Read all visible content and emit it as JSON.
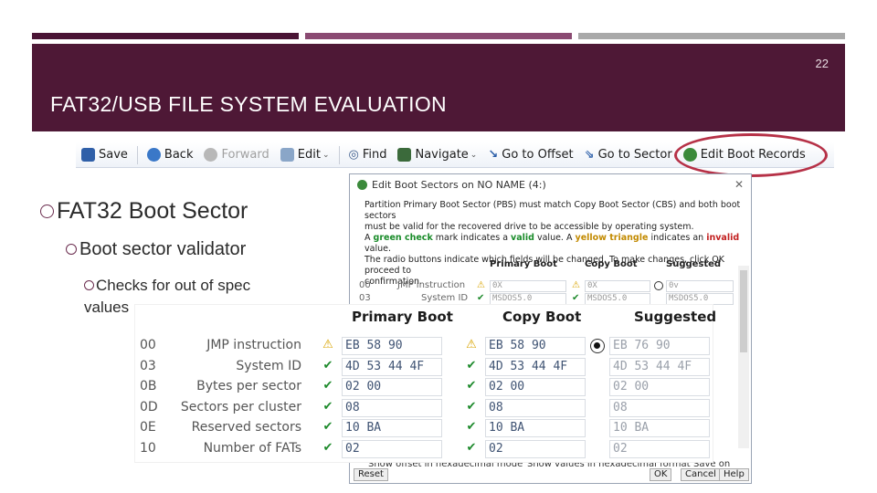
{
  "slide": {
    "number": "22",
    "title": "FAT32/USB FILE SYSTEM EVALUATION",
    "bullets": {
      "level1": "FAT32 Boot Sector",
      "level2": "Boot sector validator",
      "level3": "Checks for out of spec values"
    }
  },
  "toolbar": {
    "save": "Save",
    "back": "Back",
    "forward": "Forward",
    "edit": "Edit",
    "find": "Find",
    "navigate": "Navigate",
    "go_to_offset": "Go to Offset",
    "go_to_sector": "Go to Sector",
    "edit_boot_records": "Edit Boot Records"
  },
  "dialog": {
    "title": "Edit Boot Sectors on NO NAME (4:)",
    "desc_line1": "Partition Primary Boot Sector (PBS) must match Copy Boot Sector (CBS) and both boot sectors",
    "desc_line2": "must be valid for the recovered drive to be accessible by operating system.",
    "desc_green_prefix": "A ",
    "desc_green": "green check",
    "desc_green_mid": " mark indicates a ",
    "desc_valid": "valid",
    "desc_green_suffix": " value. A ",
    "desc_yellow": "yellow triangle",
    "desc_yellow_mid": " indicates an ",
    "desc_invalid": "invalid",
    "desc_yellow_suffix": " value.",
    "desc_line4": "The radio buttons indicate which fields will be changed. To make changes, click OK proceed to",
    "desc_line5": "confirmation.",
    "col_primary": "Primary Boot",
    "col_copy": "Copy Boot",
    "col_suggested": "Suggested",
    "rows": [
      {
        "offset": "00",
        "label": "JMP instruction",
        "primary": "0X",
        "copy": "0X",
        "suggested": "0v"
      },
      {
        "offset": "03",
        "label": "System ID",
        "primary": "MSDOS5.0",
        "copy": "MSDOS5.0",
        "suggested": "MSDOS5.0"
      }
    ],
    "opt_offset": "Show offset in hexadecimal mode",
    "opt_values": "Show values in hexadecimal format",
    "opt_save": "Save on Disk",
    "btn_reset": "Reset",
    "btn_ok": "OK",
    "btn_cancel": "Cancel",
    "btn_help": "Help",
    "close_glyph": "✕"
  },
  "zoom": {
    "col_primary": "Primary Boot",
    "col_copy": "Copy Boot",
    "col_suggested": "Suggested",
    "rows": [
      {
        "offset": "00",
        "label": "JMP instruction",
        "primary": "EB 58 90",
        "copy": "EB 58 90",
        "suggested": "EB 76 90",
        "status_primary": "warn",
        "status_copy": "warn"
      },
      {
        "offset": "03",
        "label": "System ID",
        "primary": "4D 53 44 4F",
        "copy": "4D 53 44 4F",
        "suggested": "4D 53 44 4F",
        "status_primary": "ok",
        "status_copy": "ok"
      },
      {
        "offset": "0B",
        "label": "Bytes per sector",
        "primary": "02 00",
        "copy": "02 00",
        "suggested": "02 00",
        "status_primary": "ok",
        "status_copy": "ok"
      },
      {
        "offset": "0D",
        "label": "Sectors per cluster",
        "primary": "08",
        "copy": "08",
        "suggested": "08",
        "status_primary": "ok",
        "status_copy": "ok"
      },
      {
        "offset": "0E",
        "label": "Reserved sectors",
        "primary": "10 BA",
        "copy": "10 BA",
        "suggested": "10 BA",
        "status_primary": "ok",
        "status_copy": "ok"
      },
      {
        "offset": "10",
        "label": "Number of FATs",
        "primary": "02",
        "copy": "02",
        "suggested": "02",
        "status_primary": "ok",
        "status_copy": "ok"
      }
    ]
  },
  "glyphs": {
    "ok": "✔",
    "warn": "⚠",
    "caret": "⌄"
  },
  "colors": {
    "banner": "#4e1836",
    "highlight": "#b63147",
    "valid": "#1e8a2c",
    "invalid": "#d9a400"
  }
}
